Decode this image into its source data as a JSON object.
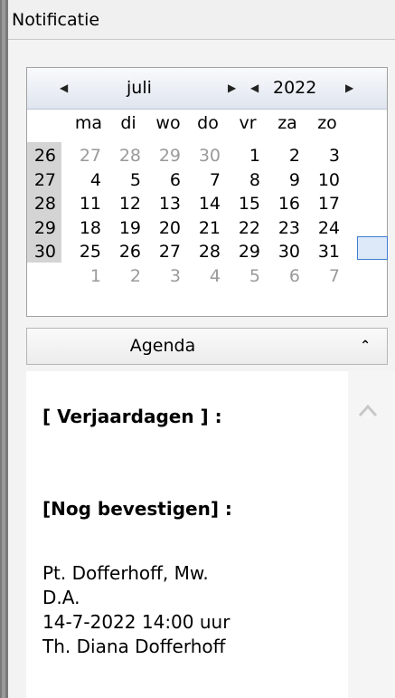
{
  "header": {
    "title": "Notificatie"
  },
  "calendar": {
    "month": "juli",
    "year": "2022",
    "weekdays": [
      "ma",
      "di",
      "wo",
      "do",
      "vr",
      "za",
      "zo"
    ],
    "weeks": [
      {
        "week": "26",
        "days": [
          "27",
          "28",
          "29",
          "30",
          "1",
          "2",
          "3"
        ]
      },
      {
        "week": "27",
        "days": [
          "4",
          "5",
          "6",
          "7",
          "8",
          "9",
          "10"
        ]
      },
      {
        "week": "28",
        "days": [
          "11",
          "12",
          "13",
          "14",
          "15",
          "16",
          "17"
        ]
      },
      {
        "week": "29",
        "days": [
          "18",
          "19",
          "20",
          "21",
          "22",
          "23",
          "24"
        ]
      },
      {
        "week": "30",
        "days": [
          "25",
          "26",
          "27",
          "28",
          "29",
          "30",
          "31"
        ]
      },
      {
        "week": "",
        "days": [
          "1",
          "2",
          "3",
          "4",
          "5",
          "6",
          "7"
        ]
      }
    ],
    "selected_day": "10"
  },
  "agenda": {
    "label": "Agenda",
    "birthdays_heading": "[ Verjaardagen ] :",
    "pending_heading": "[Nog bevestigen] :",
    "entry": {
      "line1": "Pt. Dofferhoff, Mw.",
      "line2": "D.A.",
      "line3": "14-7-2022 14:00 uur",
      "line4": "Th. Diana Dofferhoff"
    }
  }
}
